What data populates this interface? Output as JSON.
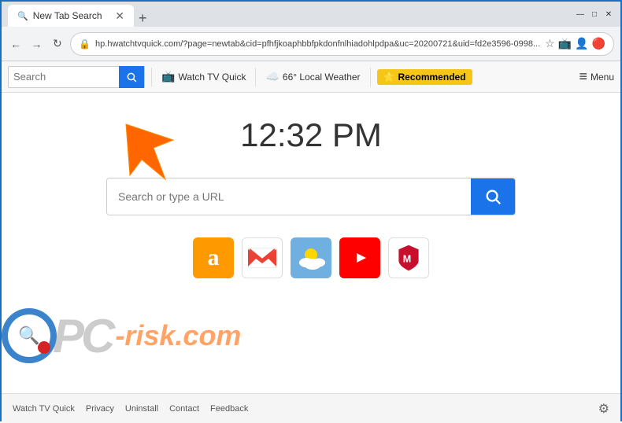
{
  "browser": {
    "tab_title": "New Tab Search",
    "tab_icon": "🔍",
    "new_tab_btn": "+",
    "url": "hp.hwatchtvquick.com/?page=newtab&cid=pfhfjkoaphbbfpkdonfnlhiadohlpdpa&uc=20200721&uid=fd2e3596-0998...",
    "nav": {
      "back": "←",
      "forward": "→",
      "refresh": "↻"
    },
    "window_controls": {
      "minimize": "—",
      "maximize": "□",
      "close": "✕"
    }
  },
  "toolbar": {
    "search_placeholder": "Search",
    "search_btn_icon": "🔍",
    "watch_tv_label": "Watch TV Quick",
    "weather_label": "66° Local Weather",
    "recommended_label": "Recommended",
    "menu_label": "Menu",
    "menu_icon": "≡"
  },
  "main": {
    "clock": "12:32 PM",
    "search_placeholder": "Search or type a URL",
    "search_btn_icon": "🔍",
    "quicklinks": [
      {
        "name": "amazon",
        "label": "Amazon",
        "color": "#FF9900",
        "icon": "a"
      },
      {
        "name": "gmail",
        "label": "Gmail",
        "color": "#EA4335",
        "icon": "m"
      },
      {
        "name": "weather",
        "label": "Weather",
        "color": "#4A90D9",
        "icon": "☁"
      },
      {
        "name": "youtube",
        "label": "YouTube",
        "color": "#FF0000",
        "icon": "▶"
      },
      {
        "name": "mcafee",
        "label": "McAfee",
        "color": "#C8102E",
        "icon": "M"
      }
    ]
  },
  "footer": {
    "links": [
      {
        "label": "Watch TV Quick"
      },
      {
        "label": "Privacy"
      },
      {
        "label": "Uninstall"
      },
      {
        "label": "Contact"
      },
      {
        "label": "Feedback"
      }
    ],
    "gear": "⚙"
  },
  "watermark": {
    "pc_text": "PC",
    "risk_text": "risk.com"
  }
}
